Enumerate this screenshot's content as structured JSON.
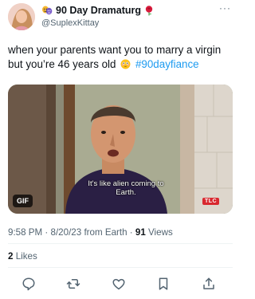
{
  "author": {
    "display_name": "90 Day Dramaturg",
    "handle": "@SuplexKittay",
    "name_left_icon": "performing-arts-emoji-icon",
    "name_right_icon": "rose-emoji-icon"
  },
  "more_icon": "more-icon",
  "tweet": {
    "text_before": "when your parents want you to marry a virgin but you’re 46 years old",
    "emoji": "flushed-face-emoji-icon",
    "hashtag": "#90dayfiance"
  },
  "media": {
    "caption_line1": "It's like alien coming to",
    "caption_line2": "Earth.",
    "gif_badge": "GIF",
    "network_badge": "TLC"
  },
  "meta": {
    "time": "9:58 PM",
    "date": "8/20/23",
    "source": "from Earth",
    "views_count": "91",
    "views_label": "Views"
  },
  "engagement": {
    "likes_count": "2",
    "likes_label": "Likes"
  },
  "actions": [
    "reply-icon",
    "retweet-icon",
    "like-icon",
    "bookmark-icon",
    "share-icon"
  ],
  "colors": {
    "link": "#1d9bf0",
    "secondary_text": "#536471",
    "primary_text": "#0f1419",
    "divider": "#eff3f4",
    "network_red": "#d8282f"
  }
}
